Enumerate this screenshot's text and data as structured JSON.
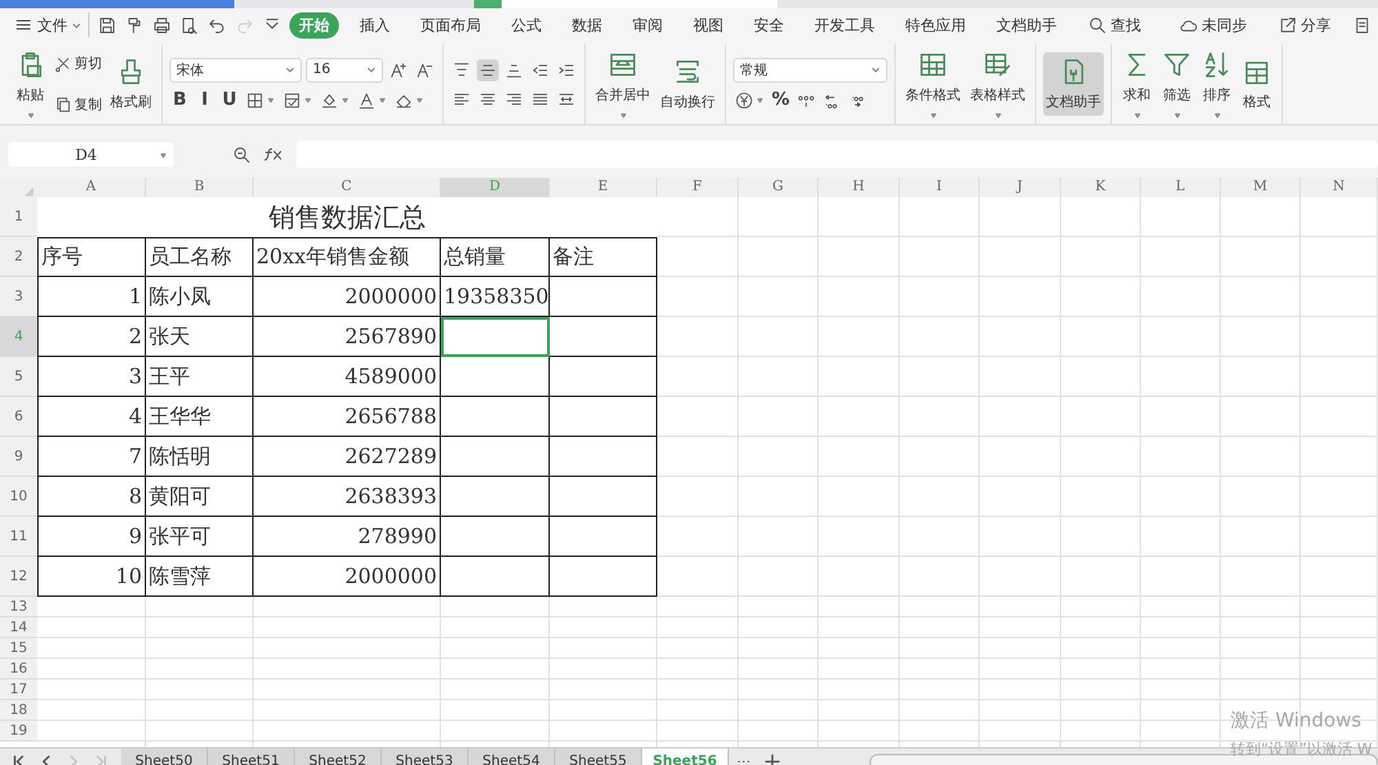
{
  "document_tabs": [
    {
      "selected": false
    },
    {
      "selected": false
    },
    {
      "selected": true
    }
  ],
  "menu": {
    "file": "文件",
    "quick_tools": [
      {
        "kind": "save",
        "disabled": false
      },
      {
        "kind": "painter",
        "disabled": false
      },
      {
        "kind": "print",
        "disabled": false
      },
      {
        "kind": "preview",
        "disabled": false
      },
      {
        "kind": "undo",
        "disabled": false
      },
      {
        "kind": "redo",
        "disabled": true
      },
      {
        "kind": "more",
        "disabled": false
      }
    ],
    "tabs": [
      {
        "label": "开始",
        "selected": true
      },
      {
        "label": "插入",
        "selected": false
      },
      {
        "label": "页面布局",
        "selected": false
      },
      {
        "label": "公式",
        "selected": false
      },
      {
        "label": "数据",
        "selected": false
      },
      {
        "label": "审阅",
        "selected": false
      },
      {
        "label": "视图",
        "selected": false
      },
      {
        "label": "安全",
        "selected": false
      },
      {
        "label": "开发工具",
        "selected": false
      },
      {
        "label": "特色应用",
        "selected": false
      },
      {
        "label": "文档助手",
        "selected": false
      }
    ],
    "search": "查找",
    "sync": "未同步",
    "share": "分享"
  },
  "ribbon": [
    {
      "columns": [
        [
          {
            "kind": "paste",
            "label": "粘贴",
            "dropdown": true
          }
        ],
        [
          {
            "kind": "cut",
            "label": "剪切"
          },
          {
            "kind": "copy",
            "label": "复制"
          }
        ],
        [
          {
            "kind": "brush",
            "label": "格式刷"
          }
        ]
      ]
    },
    {
      "rows": [
        [
          {
            "kind": "font",
            "label": "宋体"
          },
          {
            "kind": "size",
            "label": "16"
          },
          {
            "kind": "grow"
          },
          {
            "kind": "shrink"
          }
        ],
        [
          {
            "kind": "glyph",
            "label": "B"
          },
          {
            "kind": "glyph",
            "label": "I"
          },
          {
            "kind": "glyph",
            "label": "U"
          },
          {
            "kind": "border",
            "dropdown": true
          },
          {
            "kind": "cellstyle",
            "dropdown": true
          },
          {
            "kind": "fill",
            "dropdown": true
          },
          {
            "kind": "fontcolor",
            "dropdown": true
          },
          {
            "kind": "eraser",
            "dropdown": true
          }
        ]
      ]
    },
    {
      "rows": [
        [
          {
            "kind": "top"
          },
          {
            "kind": "middle",
            "selected": true
          },
          {
            "kind": "bottom"
          },
          {
            "kind": "outdent"
          },
          {
            "kind": "indent"
          }
        ],
        [
          {
            "kind": "left"
          },
          {
            "kind": "center"
          },
          {
            "kind": "right"
          },
          {
            "kind": "justify"
          },
          {
            "kind": "distribute"
          }
        ]
      ]
    },
    {
      "columns": [
        [
          {
            "kind": "merge",
            "label": "合并居中",
            "dropdown": true
          }
        ],
        [
          {
            "kind": "wrap",
            "label": "自动换行"
          }
        ]
      ]
    },
    {
      "rows": [
        [
          {
            "kind": "format",
            "label": "常规"
          }
        ],
        [
          {
            "kind": "currency",
            "dropdown": true
          },
          {
            "kind": "glyph",
            "label": "%"
          },
          {
            "kind": "thousands"
          },
          {
            "kind": "incdec"
          },
          {
            "kind": "decdec"
          }
        ]
      ]
    },
    {
      "columns": [
        [
          {
            "kind": "condfmt",
            "label": "条件格式",
            "dropdown": true
          }
        ],
        [
          {
            "kind": "tablestyle",
            "label": "表格样式",
            "dropdown": true
          }
        ]
      ]
    },
    {
      "columns": [
        [
          {
            "kind": "assistant",
            "label": "文档助手",
            "selected": true
          }
        ]
      ]
    },
    {
      "columns": [
        [
          {
            "kind": "sum",
            "label": "求和",
            "dropdown": true
          }
        ],
        [
          {
            "kind": "filter",
            "label": "筛选",
            "dropdown": true
          }
        ],
        [
          {
            "kind": "sort",
            "label": "排序",
            "dropdown": true
          }
        ],
        [
          {
            "kind": "cells",
            "label": "格式"
          }
        ]
      ]
    }
  ],
  "formula_bar": {
    "name_box": "D4"
  },
  "columns": [
    {
      "label": "A",
      "selected": false
    },
    {
      "label": "B",
      "selected": false
    },
    {
      "label": "C",
      "selected": false
    },
    {
      "label": "D",
      "selected": true
    },
    {
      "label": "E",
      "selected": false
    },
    {
      "label": "F",
      "selected": false
    },
    {
      "label": "G",
      "selected": false
    },
    {
      "label": "H",
      "selected": false
    },
    {
      "label": "I",
      "selected": false
    },
    {
      "label": "J",
      "selected": false
    },
    {
      "label": "K",
      "selected": false
    },
    {
      "label": "L",
      "selected": false
    },
    {
      "label": "M",
      "selected": false
    },
    {
      "label": "N",
      "selected": false
    }
  ],
  "rows": [
    {
      "number": "1",
      "kind": "title",
      "selected": false,
      "cells": [
        "销售数据汇总"
      ]
    },
    {
      "number": "2",
      "kind": "header",
      "selected": false,
      "cells": [
        "序号",
        "员工名称",
        "20xx年销售金额",
        "总销量",
        "备注"
      ]
    },
    {
      "number": "3",
      "kind": "data",
      "selected": false,
      "cells": [
        "1",
        "陈小凤",
        "2000000",
        "19358350",
        ""
      ]
    },
    {
      "number": "4",
      "kind": "data",
      "selected": true,
      "cells": [
        "2",
        "张天",
        "2567890",
        "",
        ""
      ]
    },
    {
      "number": "5",
      "kind": "data",
      "selected": false,
      "cells": [
        "3",
        "王平",
        "4589000",
        "",
        ""
      ]
    },
    {
      "number": "6",
      "kind": "data",
      "selected": false,
      "cells": [
        "4",
        "王华华",
        "2656788",
        "",
        ""
      ]
    },
    {
      "number": "9",
      "kind": "data",
      "selected": false,
      "cells": [
        "7",
        "陈恬明",
        "2627289",
        "",
        ""
      ]
    },
    {
      "number": "10",
      "kind": "data",
      "selected": false,
      "cells": [
        "8",
        "黄阳可",
        "2638393",
        "",
        ""
      ]
    },
    {
      "number": "11",
      "kind": "data",
      "selected": false,
      "cells": [
        "9",
        "张平可",
        "278990",
        "",
        ""
      ]
    },
    {
      "number": "12",
      "kind": "data",
      "selected": false,
      "cells": [
        "10",
        "陈雪萍",
        "2000000",
        "",
        ""
      ]
    },
    {
      "number": "13",
      "kind": "empty",
      "selected": false
    },
    {
      "number": "14",
      "kind": "empty",
      "selected": false
    },
    {
      "number": "15",
      "kind": "empty",
      "selected": false
    },
    {
      "number": "16",
      "kind": "empty",
      "selected": false
    },
    {
      "number": "17",
      "kind": "empty",
      "selected": false
    },
    {
      "number": "18",
      "kind": "empty",
      "selected": false
    },
    {
      "number": "19",
      "kind": "empty",
      "selected": false
    }
  ],
  "sheet_tabs": [
    {
      "label": "Sheet50",
      "selected": false
    },
    {
      "label": "Sheet51",
      "selected": false
    },
    {
      "label": "Sheet52",
      "selected": false
    },
    {
      "label": "Sheet53",
      "selected": false
    },
    {
      "label": "Sheet54",
      "selected": false
    },
    {
      "label": "Sheet55",
      "selected": false
    },
    {
      "label": "Sheet56",
      "selected": true
    }
  ],
  "activation_notice": {
    "title": "激活 Windows",
    "hint": "转到“设置”以激活 W"
  }
}
